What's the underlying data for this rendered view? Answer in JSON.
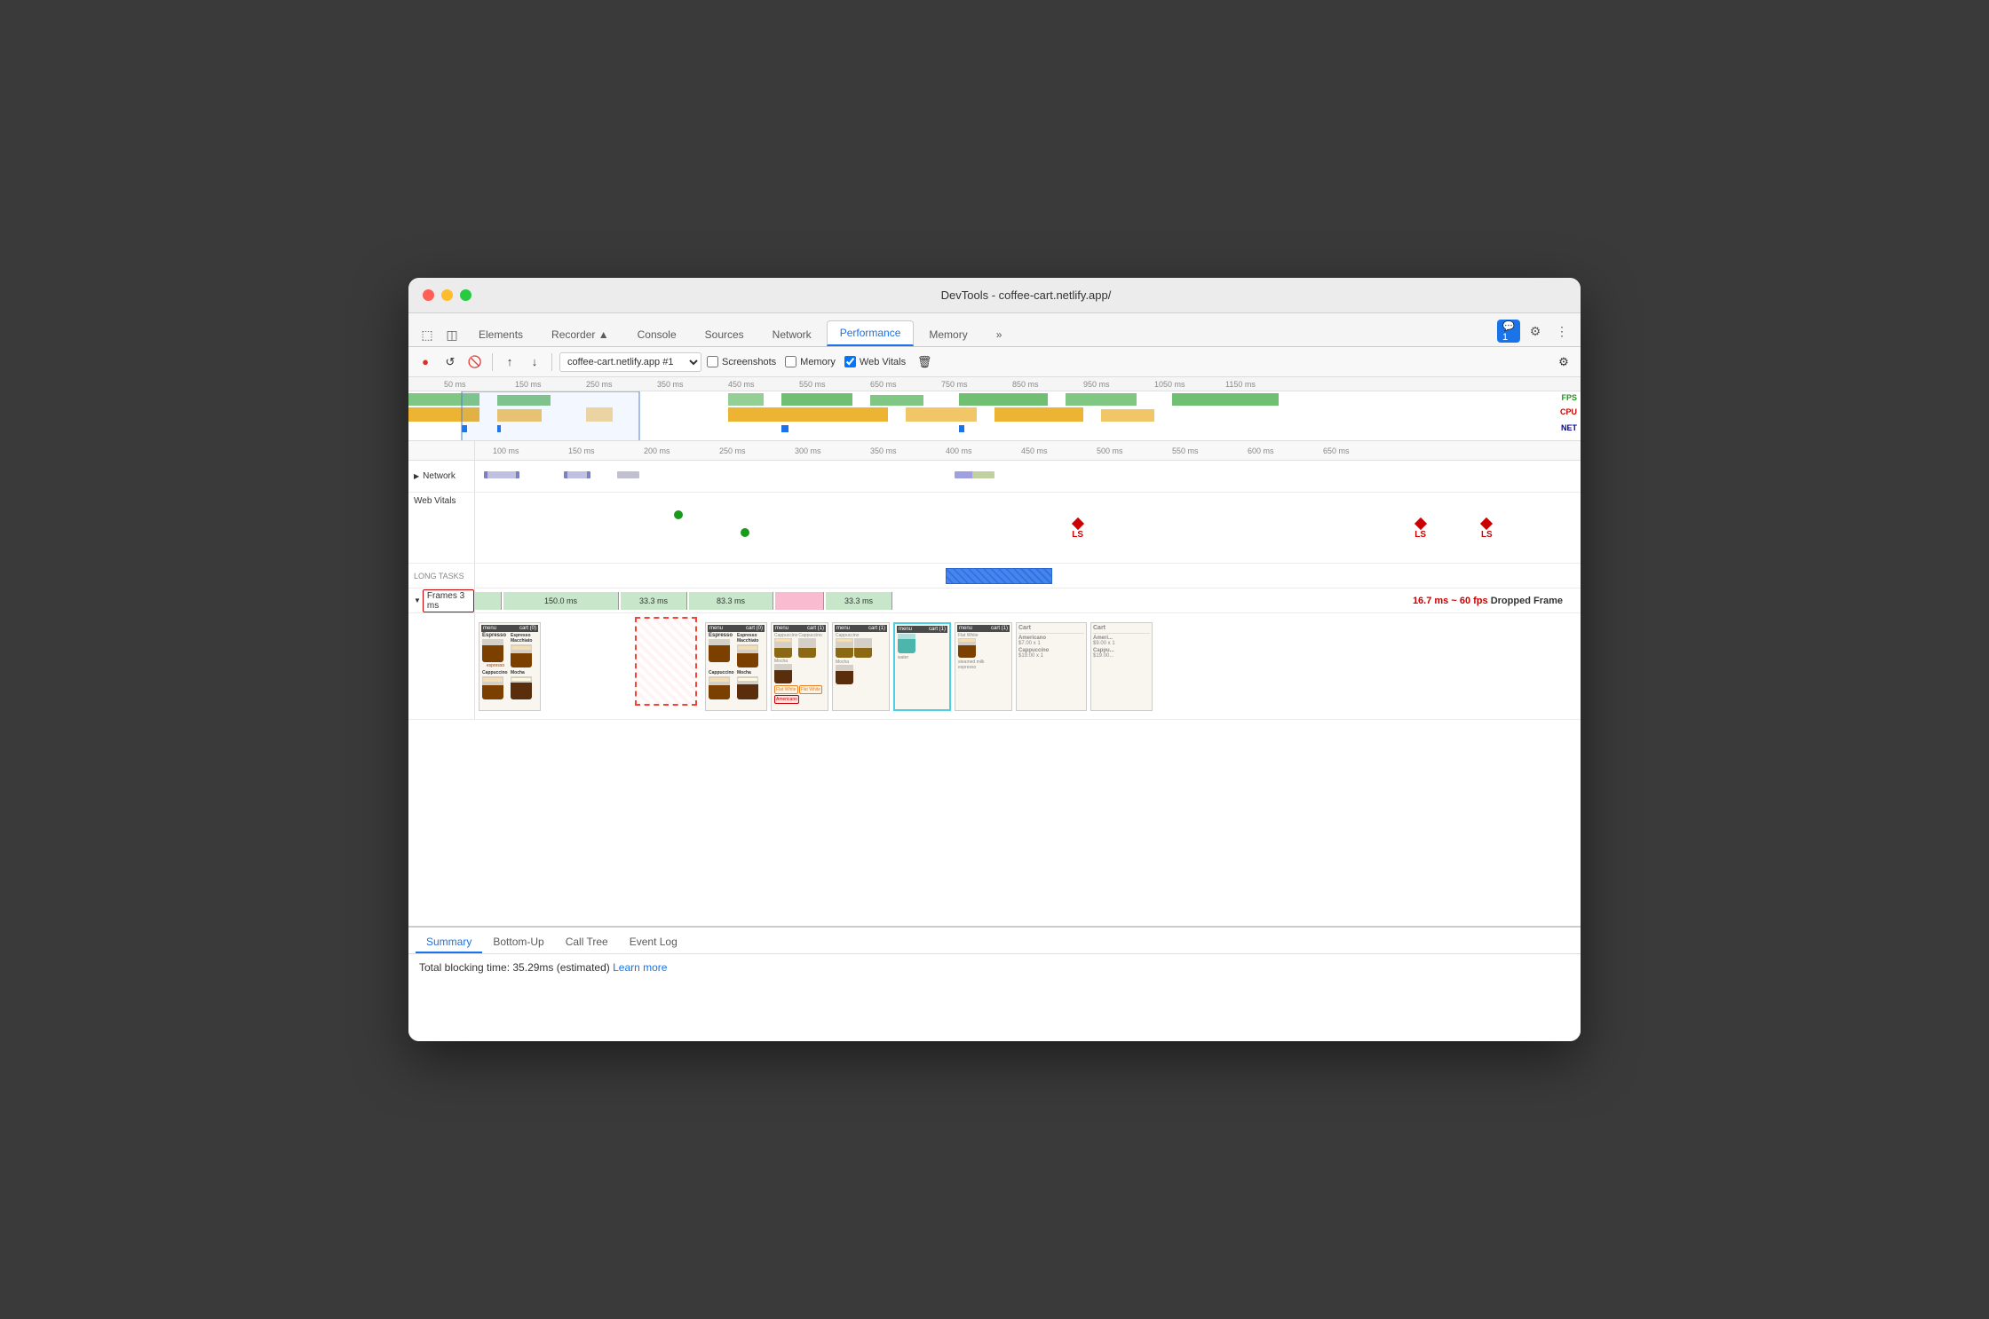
{
  "window": {
    "title": "DevTools - coffee-cart.netlify.app/"
  },
  "traffic_lights": {
    "red": "close",
    "yellow": "minimize",
    "green": "maximize"
  },
  "tabs": [
    {
      "label": "Elements",
      "active": false
    },
    {
      "label": "Recorder ▲",
      "active": false
    },
    {
      "label": "Console",
      "active": false
    },
    {
      "label": "Sources",
      "active": false
    },
    {
      "label": "Network",
      "active": false
    },
    {
      "label": "Performance",
      "active": true
    },
    {
      "label": "Memory",
      "active": false
    },
    {
      "label": "»",
      "active": false
    }
  ],
  "toolbar": {
    "record_label": "●",
    "reload_label": "↺",
    "clear_label": "🚫",
    "upload_label": "↑",
    "download_label": "↓",
    "profile_select": "coffee-cart.netlify.app #1",
    "screenshots_label": "Screenshots",
    "memory_label": "Memory",
    "web_vitals_label": "Web Vitals",
    "settings_label": "⚙"
  },
  "overview": {
    "timescale_marks": [
      "50 ms",
      "150 ms",
      "250 ms",
      "350 ms",
      "450 ms",
      "550 ms",
      "650 ms",
      "750 ms",
      "850 ms",
      "950 ms",
      "1050 ms",
      "1150 ms"
    ],
    "fps_label": "FPS",
    "cpu_label": "CPU",
    "net_label": "NET"
  },
  "timeline": {
    "ruler_marks": [
      "100 ms",
      "150 ms",
      "200 ms",
      "250 ms",
      "300 ms",
      "350 ms",
      "400 ms",
      "450 ms",
      "500 ms",
      "550 ms",
      "600 ms",
      "650 ms"
    ],
    "tracks": {
      "network_label": "Network",
      "web_vitals_label": "Web Vitals",
      "long_tasks_label": "LONG TASKS",
      "frames_label": "Frames",
      "frames_selected": "3 ms"
    }
  },
  "frames": {
    "segments": [
      {
        "label": "",
        "width_pct": 3,
        "type": "green"
      },
      {
        "label": "150.0 ms",
        "width_pct": 12,
        "type": "green"
      },
      {
        "label": "33.3 ms",
        "width_pct": 7,
        "type": "green"
      },
      {
        "label": "83.3 ms",
        "width_pct": 9,
        "type": "green"
      },
      {
        "label": "33.3 ms",
        "width_pct": 7,
        "type": "pink"
      },
      {
        "label": "",
        "width_pct": 5,
        "type": "green"
      }
    ]
  },
  "web_vitals": {
    "ls_markers": [
      {
        "label": "LS",
        "position_pct": 54
      },
      {
        "label": "LS",
        "position_pct": 85
      },
      {
        "label": "LS",
        "position_pct": 91
      }
    ],
    "dots": [
      {
        "position_pct": 18,
        "row": 1
      },
      {
        "position_pct": 23,
        "row": 2
      }
    ]
  },
  "dropped_frame": {
    "label": "16.7 ms ~ 60 fps",
    "suffix": "Dropped Frame"
  },
  "bottom_panel": {
    "tabs": [
      "Summary",
      "Bottom-Up",
      "Call Tree",
      "Event Log"
    ],
    "active_tab": "Summary",
    "summary_text": "Total blocking time: 35.29ms (estimated)",
    "learn_more_label": "Learn more"
  }
}
